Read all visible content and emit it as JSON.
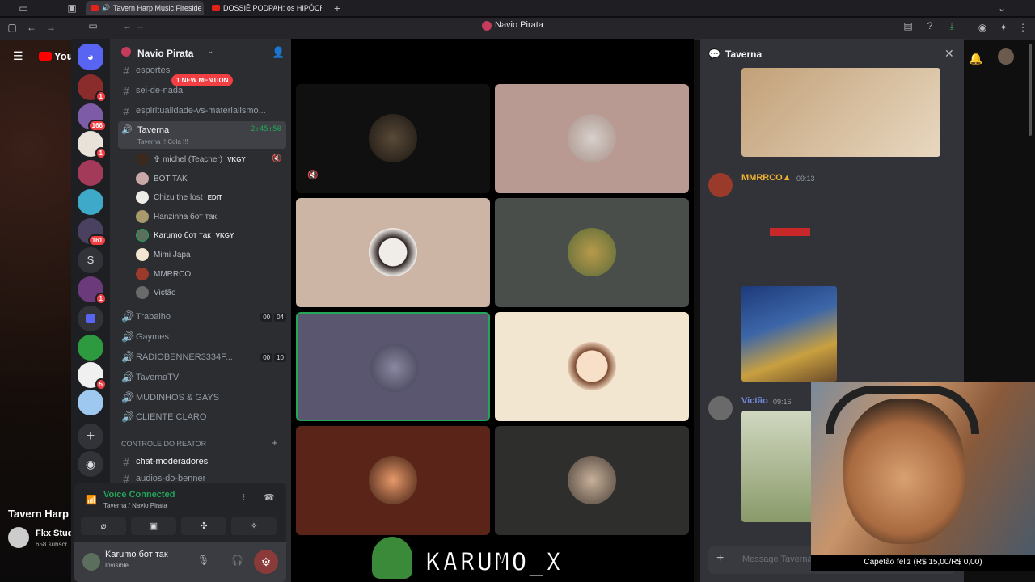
{
  "browser": {
    "tabs": [
      {
        "label": "Tavern Harp Music Fireside"
      },
      {
        "label": "DOSSIÊ PODPAH: os HIPÓCRIT..."
      }
    ],
    "address_title": "Navio Pirata"
  },
  "youtube": {
    "logo": "You",
    "video_title": "Tavern Harp",
    "channel_name": "Fkx Stud",
    "subs": "658 subscr"
  },
  "servers": [
    {
      "badge": "1"
    },
    {
      "badge": "166"
    },
    {
      "badge": "1"
    },
    {
      "badge": ""
    },
    {
      "badge": ""
    },
    {
      "badge": "161"
    },
    {
      "letter": "S"
    },
    {
      "badge": "1"
    },
    {
      "badge": ""
    },
    {
      "badge": ""
    },
    {
      "badge": "5"
    },
    {
      "badge": ""
    }
  ],
  "sidebar": {
    "server_name": "Navio Pirata",
    "mention_pill": "1 NEW MENTION",
    "channels_top": [
      {
        "label": "esportes"
      },
      {
        "label": "sei-de-nada"
      },
      {
        "label": "espiritualidade-vs-materialismo..."
      }
    ],
    "voice_active": {
      "label": "Taverna",
      "sub": "Taverna !! Cola !!!",
      "time": "2:45:50"
    },
    "voice_users": [
      {
        "name": "✞ michel (Teacher)",
        "tag": "VKGY"
      },
      {
        "name": "BOT TAK",
        "tag": ""
      },
      {
        "name": "Chizu the lost",
        "tag": "EDIT"
      },
      {
        "name": "Hanzinha бот так",
        "tag": ""
      },
      {
        "name": "Karumo бот так",
        "tag": "VKGY"
      },
      {
        "name": "Mimi Japa",
        "tag": ""
      },
      {
        "name": "MMRRCO",
        "tag": ""
      },
      {
        "name": "Victão",
        "tag": ""
      }
    ],
    "voice_channels": [
      {
        "label": "Trabalho",
        "c1": "00",
        "c2": "04"
      },
      {
        "label": "Gaymes",
        "c1": "",
        "c2": ""
      },
      {
        "label": "RADIOBENNER3334F...",
        "c1": "00",
        "c2": "10"
      },
      {
        "label": "TavernaTV",
        "c1": "",
        "c2": ""
      },
      {
        "label": "MUDINHOS & GAYS",
        "c1": "",
        "c2": ""
      },
      {
        "label": "CLIENTE CLARO",
        "c1": "",
        "c2": ""
      }
    ],
    "category": "CONTROLE DO REATOR",
    "category_channels": [
      {
        "label": "chat-moderadores"
      },
      {
        "label": "audios-do-benner"
      }
    ],
    "voice_status": {
      "title": "Voice Connected",
      "sub": "Taverna / Navio Pirata"
    },
    "user": {
      "name": "Karumo бот так",
      "status": "Invisible"
    }
  },
  "stage": {
    "banner_text": "KARUMO_X"
  },
  "chat": {
    "title": "Taverna",
    "messages": [
      {
        "author": "MMRRCO▲",
        "time": "09:13",
        "color": "#f0b232"
      },
      {
        "author": "Victão",
        "time": "09:16",
        "color": "#7289da"
      }
    ],
    "input_placeholder": "Message Taverna"
  },
  "overlay": {
    "caption": "Capetão feliz (R$ 15,00/R$ 0,00)"
  },
  "colors": {
    "accent": "#5865f2",
    "green": "#23a55a",
    "red": "#f23f43"
  }
}
